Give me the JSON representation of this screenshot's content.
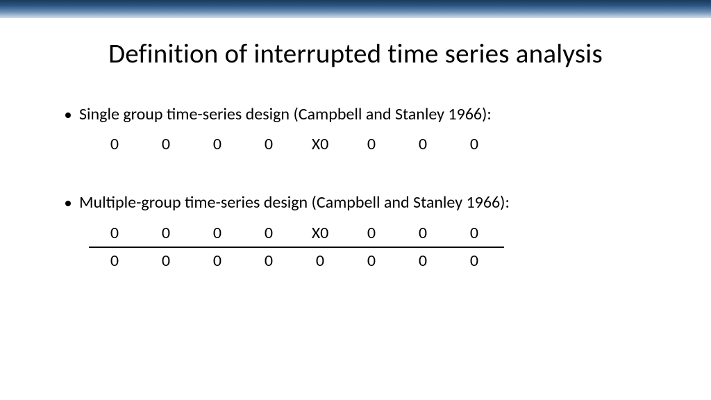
{
  "title": "Definition of interrupted time series analysis",
  "bullet1": "Single group time-series design (Campbell and Stanley 1966):",
  "bullet2": "Multiple-group time-series design (Campbell and Stanley 1966):",
  "row1": [
    "0",
    "0",
    "0",
    "0",
    "X0",
    "0",
    "0",
    "0"
  ],
  "row2": [
    "0",
    "0",
    "0",
    "0",
    "X0",
    "0",
    "0",
    "0"
  ],
  "row3": [
    "0",
    "0",
    "0",
    "0",
    "0",
    "0",
    "0",
    "0"
  ]
}
